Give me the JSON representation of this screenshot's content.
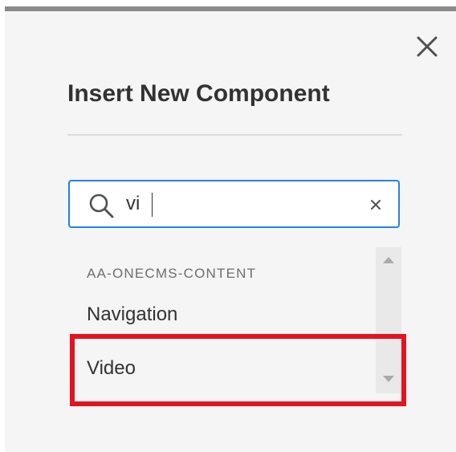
{
  "dialog": {
    "title": "Insert New Component",
    "close_icon": "close-icon"
  },
  "search": {
    "value": "vi",
    "placeholder": "",
    "icon": "search-icon",
    "clear_icon": "clear-icon"
  },
  "results": {
    "group": "AA-ONECMS-CONTENT",
    "items": [
      {
        "label": "Navigation"
      },
      {
        "label": "Video"
      }
    ]
  },
  "annotation": {
    "highlight_color": "#e3141f",
    "highlighted_item": "Video"
  },
  "colors": {
    "accent": "#2680eb",
    "background": "#f5f5f5",
    "text": "#323232"
  }
}
